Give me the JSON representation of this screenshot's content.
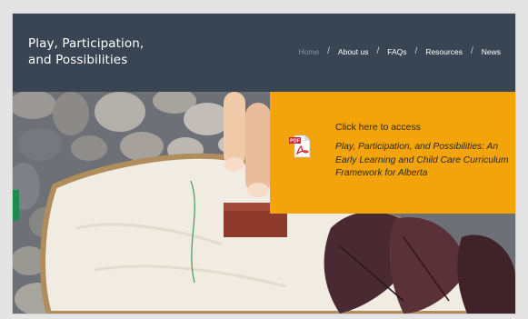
{
  "site": {
    "title_line1": "Play, Participation,",
    "title_line2": "and Possibilities"
  },
  "nav": {
    "items": [
      {
        "label": "Home",
        "active": true
      },
      {
        "label": "About us",
        "active": false
      },
      {
        "label": "FAQs",
        "active": false
      },
      {
        "label": "Resources",
        "active": false
      },
      {
        "label": "News",
        "active": false
      }
    ],
    "separator": "/"
  },
  "cta": {
    "lead": "Click here to access",
    "document_title": "Play, Participation, and Possibilities: An Early Learning and Child Care Curriculum Framework for Alberta",
    "icon": "pdf-file-icon",
    "icon_badge": "PDF"
  },
  "colors": {
    "header_bg": "#394553",
    "cta_bg": "#f2a40a",
    "nav_active": "#8391a3"
  }
}
